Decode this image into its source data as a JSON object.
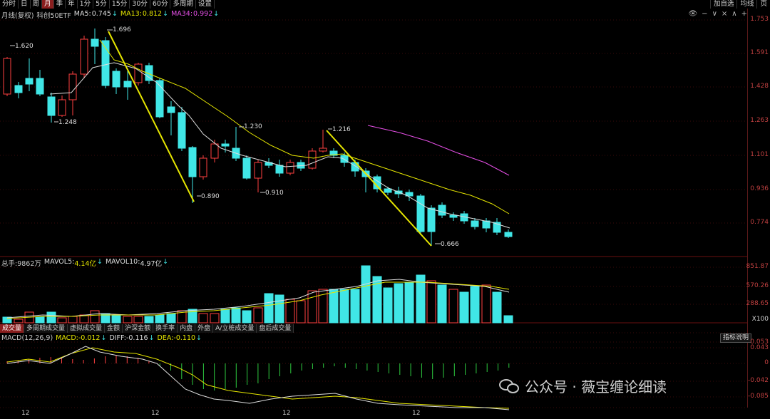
{
  "toolbar": {
    "periods": [
      "分时",
      "日",
      "周",
      "月",
      "季",
      "年",
      "1分",
      "5分",
      "15分",
      "30分",
      "60分",
      "多周期",
      "设置"
    ],
    "active_period": "月",
    "right_buttons": [
      "加自选",
      "均线",
      "页"
    ]
  },
  "info": {
    "period_label": "月线(复权)",
    "symbol": "科创50ETF",
    "ma5_label": "MA5:",
    "ma5_value": "0.745",
    "ma13_label": "MA13:",
    "ma13_value": "0.812",
    "ma34_label": "MA34:",
    "ma34_value": "0.992",
    "ma5_color": "#ffffff",
    "ma13_color": "#e6e600",
    "ma34_color": "#e64fe6"
  },
  "price_axis": [
    "1.753",
    "1.591",
    "1.428",
    "1.263",
    "1.101",
    "0.936",
    "0.774"
  ],
  "price_annotations": [
    "1.696",
    "1.620",
    "1.248",
    "1.230",
    "0.890",
    "0.910",
    "1.216",
    "0.666"
  ],
  "volume": {
    "label": "总手:",
    "value": "9862万",
    "mavol5_label": "MAVOL5:",
    "mavol5_value": "4.14亿",
    "mavol10_label": "MAVOL10:",
    "mavol10_value": "4.97亿",
    "axis": [
      "851.87",
      "570.26",
      "288.65",
      "X100"
    ]
  },
  "volume_tabs": [
    "成交量",
    "多周期成交量",
    "虚拟成交量",
    "金额",
    "沪深金额",
    "换手率",
    "内盘",
    "外盘",
    "A/立桩成交量",
    "盘后成交量"
  ],
  "macd": {
    "label": "MACD(12,26,9)",
    "macd_label": "MACD:",
    "macd_value": "-0.012",
    "diff_label": "DIFF:",
    "diff_value": "-0.116",
    "dea_label": "DEA:",
    "dea_value": "-0.110",
    "help_button": "指标说明",
    "axis": [
      "0.053",
      "0.043",
      "0",
      "-0.042",
      "-0.085"
    ]
  },
  "x_axis": [
    "12",
    "12",
    "12",
    "12"
  ],
  "watermark": "公众号 · 薇宝缠论细读",
  "colors": {
    "up": "#ff4040",
    "down": "#40e6e6",
    "trendline": "#e6e600",
    "background": "#000000",
    "axis_text": "#c04040"
  }
}
